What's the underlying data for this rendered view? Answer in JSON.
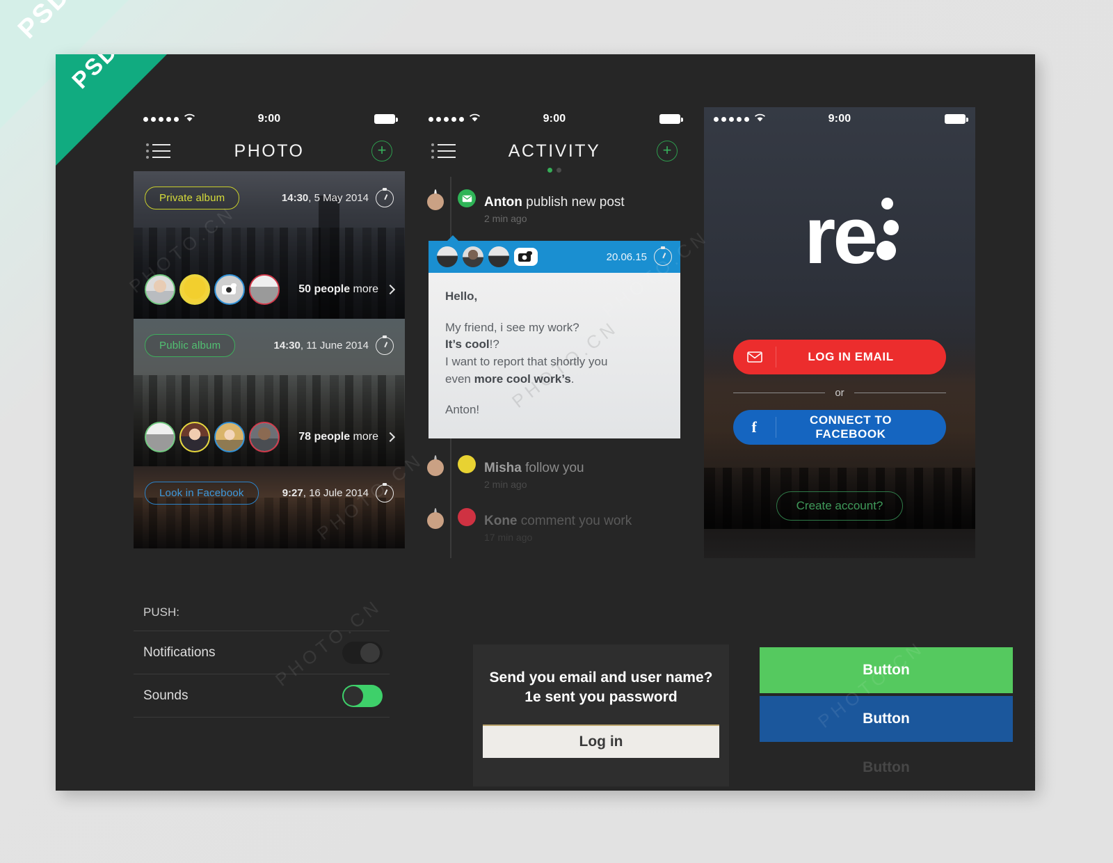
{
  "ribbon": {
    "page_label": "PSD",
    "board_label": "PSD"
  },
  "watermark_text": "PHOTO.CN",
  "colors": {
    "board_bg": "#262626",
    "accent_green": "#3ed06a",
    "accent_blue": "#1a8fd1",
    "accent_red": "#ec2d2d",
    "facebook_blue": "#1565c0",
    "ribbon_green": "#11ab80",
    "pill_yellow": "#d7dd3a",
    "pill_green": "#52c072",
    "pill_blue": "#3e9add"
  },
  "screens": {
    "photo": {
      "status_bar": {
        "time": "9:00",
        "signal_dots": 5,
        "wifi_icon": "wifi-icon",
        "battery_icon": "battery-full-icon"
      },
      "nav": {
        "menu_icon": "list-menu-icon",
        "title": "PHOTO",
        "add_icon": "plus-circle-icon"
      },
      "cards": [
        {
          "badge": "Private album",
          "badge_color": "yellow",
          "time": "14:30",
          "date": ", 5 May 2014",
          "clock_icon": "stopwatch-icon",
          "people_count": "50 people",
          "people_more": " more",
          "chevron_icon": "chevron-right-icon",
          "avatars": [
            "green",
            "yellow",
            "blue-camera",
            "red"
          ]
        },
        {
          "badge": "Public album",
          "badge_color": "green",
          "time": "14:30",
          "date": ", 11 June 2014",
          "clock_icon": "stopwatch-icon",
          "people_count": "78 people",
          "people_more": " more",
          "chevron_icon": "chevron-right-icon",
          "avatars": [
            "green",
            "yellow",
            "blue",
            "red"
          ]
        },
        {
          "badge": "Look in Facebook",
          "badge_color": "blue",
          "time": "9:27",
          "date": ", 16 Jule 2014",
          "clock_icon": "stopwatch-icon"
        }
      ]
    },
    "activity": {
      "status_bar": {
        "time": "9:00",
        "signal_dots": 5,
        "wifi_icon": "wifi-icon",
        "battery_icon": "battery-full-icon"
      },
      "nav": {
        "menu_icon": "list-menu-icon",
        "title": "ACTIVITY",
        "add_icon": "plus-circle-icon",
        "page_dots": 2,
        "active_dot": 0
      },
      "items": [
        {
          "name": "Anton",
          "action": " publish new post",
          "time": "2 min ago",
          "badge": "mail-icon",
          "badge_color": "green",
          "state": "normal"
        },
        {
          "name": "Misha",
          "action": " follow you",
          "time": "2 min ago",
          "badge": "dot-badge",
          "badge_color": "yellow",
          "state": "dim"
        },
        {
          "name": "Kone",
          "action": " comment you work",
          "time": "17 min ago",
          "badge": "dot-badge",
          "badge_color": "red",
          "state": "dim2"
        }
      ],
      "message_card": {
        "date": "20.06.15",
        "clock_icon": "stopwatch-icon",
        "avatars": [
          "man-glasses",
          "man-beard",
          "man-young",
          "camera-icon"
        ],
        "greeting": "Hello,",
        "line1": "My friend, i see my work?",
        "line2_bold": "It’s cool",
        "line2_rest": "!?",
        "line3": "I want to report that shortly you",
        "line4_pre": "even ",
        "line4_bold": "more cool work’s",
        "line4_post": ".",
        "signature": "Anton!"
      }
    },
    "login": {
      "status_bar": {
        "time": "9:00",
        "signal_dots": 5,
        "wifi_icon": "wifi-icon",
        "battery_icon": "battery-full-icon"
      },
      "logo_text": "re",
      "logo_dots_icon": "three-dots-icon",
      "email_button": {
        "label": "LOG IN EMAIL",
        "icon": "envelope-icon"
      },
      "divider_label": "or",
      "facebook_button": {
        "label": "CONNECT TO FACEBOOK",
        "icon": "facebook-f-icon"
      },
      "create_account": "Create account?"
    }
  },
  "panels": {
    "settings": {
      "section_label": "PUSH:",
      "rows": [
        {
          "label": "Notifications",
          "toggle": "off"
        },
        {
          "label": "Sounds",
          "toggle": "on"
        }
      ]
    },
    "login_panel": {
      "line1": "Send you email and user name?",
      "line2": "1e sent you password",
      "button_label": "Log in"
    },
    "buttons_panel": {
      "items": [
        {
          "label": "Button",
          "style": "green"
        },
        {
          "label": "Button",
          "style": "blue"
        },
        {
          "label": "Button",
          "style": "ghost"
        }
      ]
    }
  }
}
